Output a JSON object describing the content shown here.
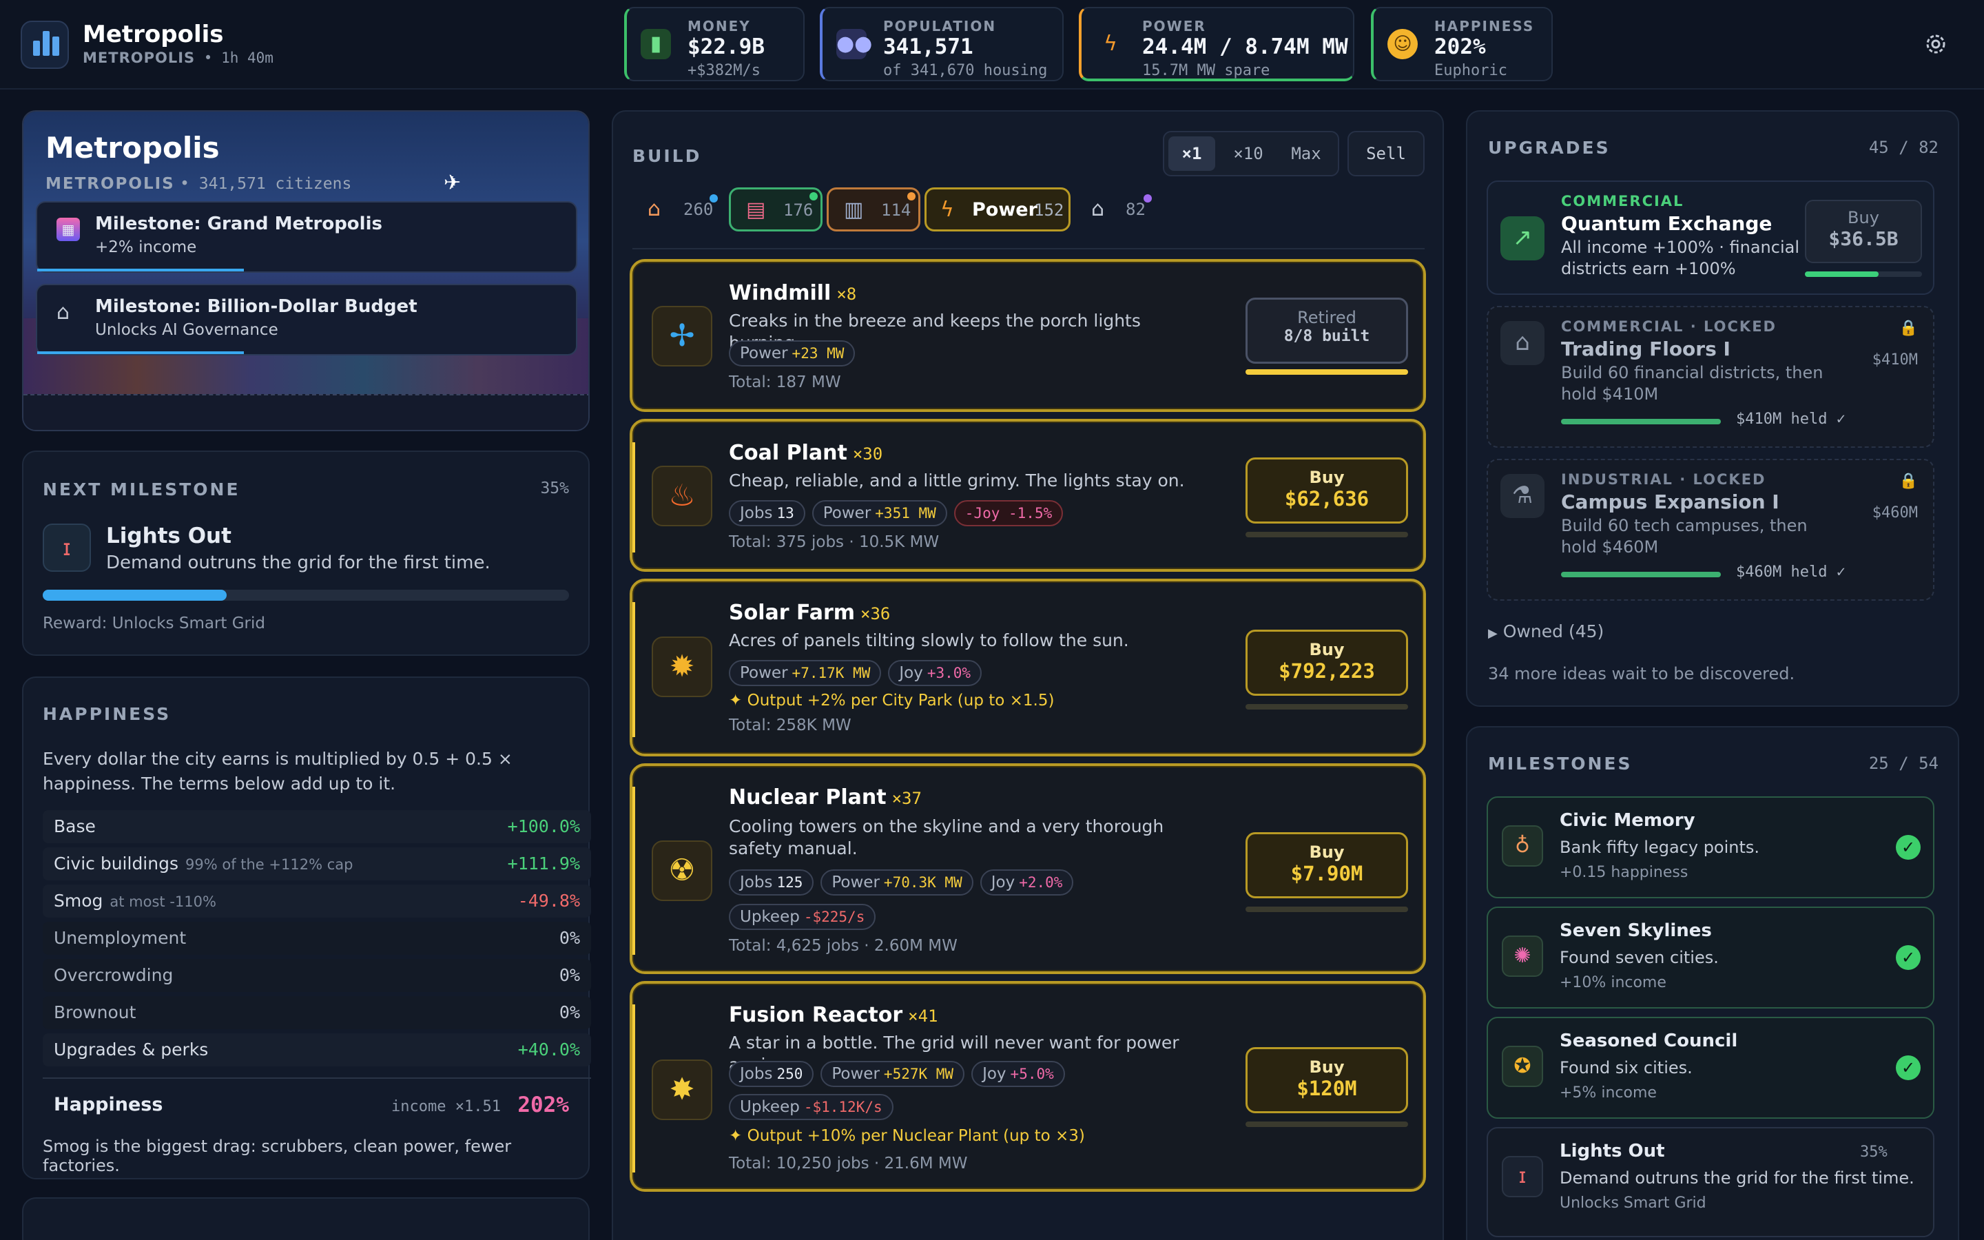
{
  "colors": {
    "accent_blue": "#39a8f0",
    "money_green": "#4ad07a",
    "power_yellow": "#f4cc3c",
    "joy_pink": "#f06aa8",
    "negative_red": "#f06a6a"
  },
  "header": {
    "city_name": "Metropolis",
    "city_sub": "METROPOLIS",
    "playtime": "1h 40m",
    "stats": [
      {
        "label": "MONEY",
        "value": "$22.9B",
        "sub": "+$382M/s",
        "icon": "money-icon"
      },
      {
        "label": "POPULATION",
        "value": "341,571",
        "sub": "of 341,670 housing",
        "icon": "people-icon"
      },
      {
        "label": "POWER",
        "value": "24.4M / 8.74M MW",
        "sub": "15.7M MW spare",
        "icon": "lightning-icon"
      },
      {
        "label": "HAPPINESS",
        "value": "202%",
        "sub": "Euphoric",
        "icon": "smile-icon"
      }
    ]
  },
  "hero": {
    "title": "Metropolis",
    "subtitle_tag": "METROPOLIS",
    "citizens": "341,571 citizens",
    "toasts": [
      {
        "title": "Milestone: Grand Metropolis",
        "sub": "+2% income"
      },
      {
        "title": "Milestone: Billion-Dollar Budget",
        "sub": "Unlocks AI Governance"
      }
    ]
  },
  "next_milestone": {
    "heading": "NEXT MILESTONE",
    "percent": "35%",
    "progress": 0.35,
    "title": "Lights Out",
    "desc": "Demand outruns the grid for the first time.",
    "reward": "Reward: Unlocks Smart Grid"
  },
  "happiness": {
    "heading": "HAPPINESS",
    "intro": "Every dollar the city earns is multiplied by 0.5 + 0.5 × happiness. The terms below add up to it.",
    "rows": [
      {
        "name": "Base",
        "note": "",
        "value": "+100.0%"
      },
      {
        "name": "Civic buildings",
        "note": "99% of the +112% cap",
        "value": "+111.9%"
      },
      {
        "name": "Smog",
        "note": "at most -110%",
        "value": "-49.8%"
      },
      {
        "name": "Unemployment",
        "note": "",
        "value": "0%"
      },
      {
        "name": "Overcrowding",
        "note": "",
        "value": "0%"
      },
      {
        "name": "Brownout",
        "note": "",
        "value": "0%"
      },
      {
        "name": "Upgrades & perks",
        "note": "",
        "value": "+40.0%"
      }
    ],
    "total_label": "Happiness",
    "total_mult": "income ×1.51",
    "total_value": "202%",
    "footer": "Smog is the biggest drag: scrubbers, clean power, fewer factories."
  },
  "build": {
    "heading": "BUILD",
    "qty": [
      "×1",
      "×10",
      "Max"
    ],
    "sell": "Sell",
    "categories": [
      {
        "icon": "house-icon",
        "count": "260"
      },
      {
        "icon": "shop-icon",
        "count": "176"
      },
      {
        "icon": "factory-icon",
        "count": "114"
      },
      {
        "icon": "lightning-icon",
        "label": "Power",
        "count": "152"
      },
      {
        "icon": "civic-icon",
        "count": "82"
      }
    ],
    "items": [
      {
        "name": "Windmill",
        "count": "×8",
        "desc": "Creaks in the breeze and keeps the porch lights burning.",
        "tags": [
          {
            "k": "Power",
            "v": "+23 MW"
          }
        ],
        "total": "Total: 187 MW",
        "btn1": "Retired",
        "btn2": "8/8 built",
        "progress": 1.0
      },
      {
        "name": "Coal Plant",
        "count": "×30",
        "desc": "Cheap, reliable, and a little grimy. The lights stay on.",
        "tags": [
          {
            "k": "Jobs",
            "v": "13"
          },
          {
            "k": "Power",
            "v": "+351 MW"
          },
          {
            "k": "",
            "v": "-Joy -1.5%"
          }
        ],
        "total": "Total: 375 jobs · 10.5K MW",
        "btn1": "Buy",
        "btn2": "$62,636",
        "progress": 0.0
      },
      {
        "name": "Solar Farm",
        "count": "×36",
        "desc": "Acres of panels tilting slowly to follow the sun.",
        "tags": [
          {
            "k": "Power",
            "v": "+7.17K MW"
          },
          {
            "k": "Joy",
            "v": "+3.0%"
          }
        ],
        "note": "Output +2% per City Park (up to ×1.5)",
        "total": "Total: 258K MW",
        "btn1": "Buy",
        "btn2": "$792,223",
        "progress": 0.0
      },
      {
        "name": "Nuclear Plant",
        "count": "×37",
        "desc": "Cooling towers on the skyline and a very thorough safety manual.",
        "tags": [
          {
            "k": "Jobs",
            "v": "125"
          },
          {
            "k": "Power",
            "v": "+70.3K MW"
          },
          {
            "k": "Joy",
            "v": "+2.0%"
          }
        ],
        "tags2": [
          {
            "k": "Upkeep",
            "v": "-$225/s"
          }
        ],
        "total": "Total: 4,625 jobs · 2.60M MW",
        "btn1": "Buy",
        "btn2": "$7.90M",
        "progress": 0.0
      },
      {
        "name": "Fusion Reactor",
        "count": "×41",
        "desc": "A star in a bottle. The grid will never want for power again.",
        "tags": [
          {
            "k": "Jobs",
            "v": "250"
          },
          {
            "k": "Power",
            "v": "+527K MW"
          },
          {
            "k": "Joy",
            "v": "+5.0%"
          }
        ],
        "tags2": [
          {
            "k": "Upkeep",
            "v": "-$1.12K/s"
          }
        ],
        "note": "Output +10% per Nuclear Plant (up to ×3)",
        "total": "Total: 10,250 jobs · 21.6M MW",
        "btn1": "Buy",
        "btn2": "$120M",
        "progress": 0.0
      }
    ]
  },
  "upgrades": {
    "heading": "UPGRADES",
    "count": "45 / 82",
    "items": [
      {
        "cat": "COMMERCIAL",
        "title": "Quantum Exchange",
        "desc": "All income +100% · financial districts earn +100%",
        "btn1": "Buy",
        "btn2": "$36.5B",
        "progress": 0.63
      },
      {
        "cat": "COMMERCIAL · LOCKED",
        "title": "Trading Floors I",
        "desc": "Build 60 financial districts, then hold $410M",
        "price": "$410M",
        "held": "$410M held ✓"
      },
      {
        "cat": "INDUSTRIAL · LOCKED",
        "title": "Campus Expansion I",
        "desc": "Build 60 tech campuses, then hold $460M",
        "price": "$460M",
        "held": "$460M held ✓"
      }
    ],
    "owned": "Owned (45)",
    "footer": "34 more ideas wait to be discovered."
  },
  "milestones": {
    "heading": "MILESTONES",
    "count": "25 / 54",
    "items": [
      {
        "title": "Civic Memory",
        "desc": "Bank fifty legacy points.",
        "reward": "+0.15 happiness",
        "icon": "vase-icon"
      },
      {
        "title": "Seven Skylines",
        "desc": "Found seven cities.",
        "reward": "+10% income",
        "icon": "fireworks-icon"
      },
      {
        "title": "Seasoned Council",
        "desc": "Found six cities.",
        "reward": "+5% income",
        "icon": "medal-icon"
      },
      {
        "title": "Lights Out",
        "percent": "35%",
        "desc": "Demand outruns the grid for the first time.",
        "reward": "Unlocks Smart Grid",
        "icon": "torch-icon"
      }
    ]
  }
}
